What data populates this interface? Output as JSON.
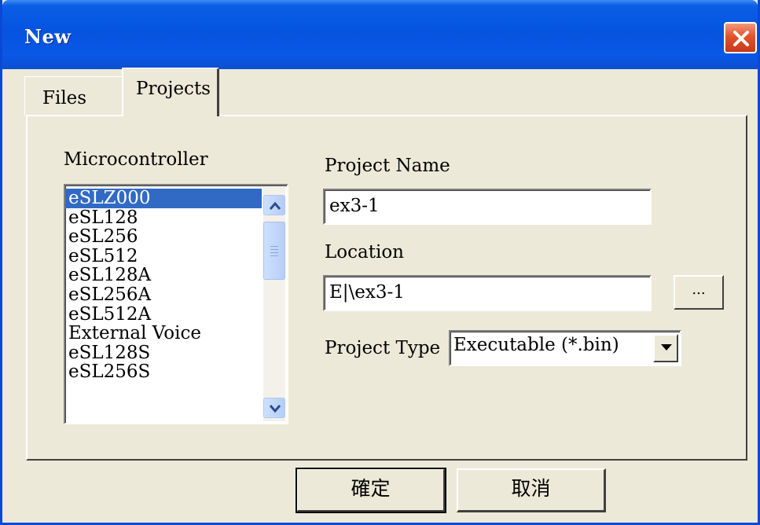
{
  "window": {
    "title": "New"
  },
  "tabs": [
    {
      "label": "Files",
      "active": false
    },
    {
      "label": "Projects",
      "active": true
    }
  ],
  "microcontroller": {
    "label": "Microcontroller",
    "selected": "eSLZ000",
    "items": [
      "eSLZ000",
      "eSL128",
      "eSL256",
      "eSL512",
      "eSL128A",
      "eSL256A",
      "eSL512A",
      "External Voice",
      "eSL128S",
      "eSL256S"
    ]
  },
  "project_name": {
    "label": "Project Name",
    "value": "ex3-1"
  },
  "location": {
    "label": "Location",
    "value": "E|\\ex3-1",
    "browse_label": "..."
  },
  "project_type": {
    "label": "Project Type",
    "value": "Executable (*.bin)"
  },
  "buttons": {
    "ok": "確定",
    "cancel": "取消"
  },
  "colors": {
    "titlebar": "#0653e0",
    "selection": "#316ac5",
    "dialog_bg": "#ece9d8"
  }
}
